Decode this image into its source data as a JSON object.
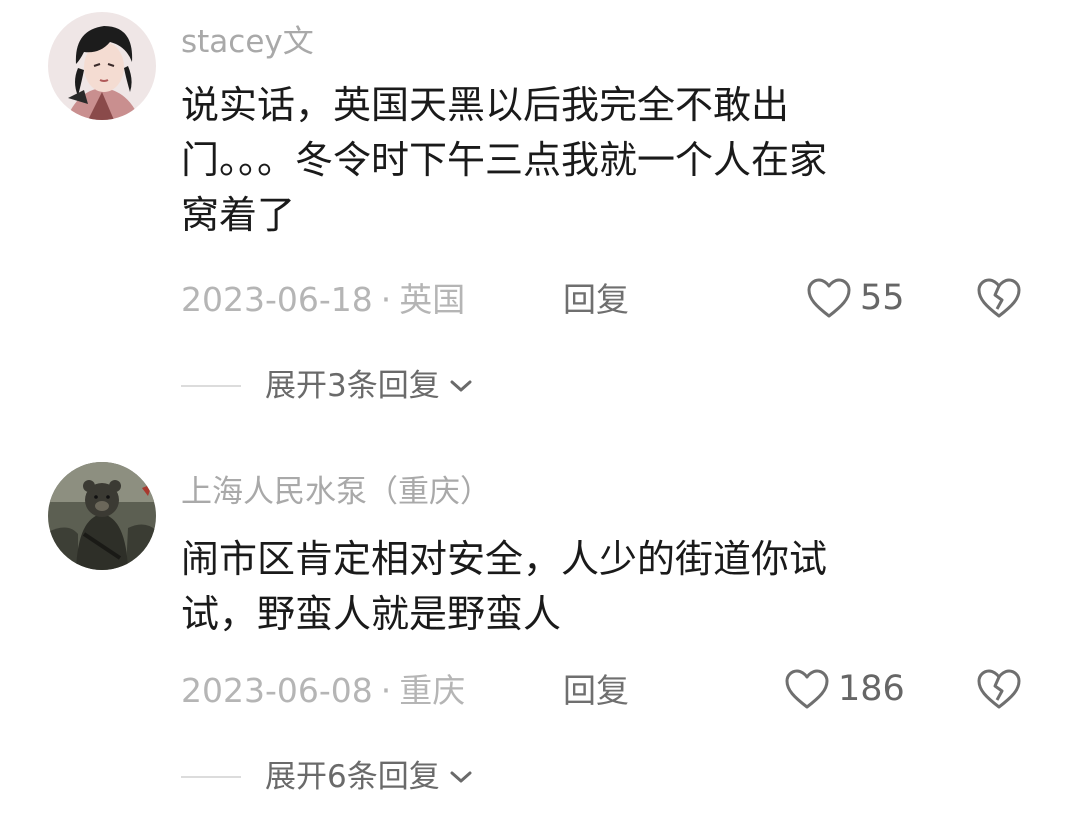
{
  "comments": [
    {
      "author": "stacey文",
      "text": "说实话，英国天黑以后我完全不敢出\n门。。。冬令时下午三点我就一个人在家\n窝着了",
      "date": "2023-06-18",
      "location": "英国",
      "reply_label": "回复",
      "likes": "55",
      "expand_label": "展开3条回复",
      "avatar_icon": "anime-man-avatar"
    },
    {
      "author": "上海人民水泵（重庆）",
      "text": "闹市区肯定相对安全，人少的街道你试\n试，野蛮人就是野蛮人",
      "date": "2023-06-08",
      "location": "重庆",
      "reply_label": "回复",
      "likes": "186",
      "expand_label": "展开6条回复",
      "avatar_icon": "bear-soldier-avatar"
    }
  ],
  "meta_separator": "·"
}
